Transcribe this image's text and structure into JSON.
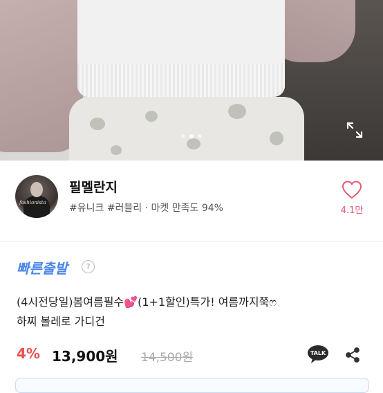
{
  "hero": {
    "slide_count": 3,
    "active_slide": 2
  },
  "seller": {
    "name": "필멜란지",
    "tags": "#유니크 #러블리 · 마켓 만족도 94%",
    "likes": "4.1만",
    "accent_color": "#e35a71"
  },
  "product": {
    "badge": "빠른출발",
    "help": "?",
    "title_line1_a": "(4시전당일)봄여름필수",
    "title_emoji": "💕",
    "title_line1_b": "(1+1할인)특가! 여름까지쭉ෆ",
    "title_line2": "하찌 볼레로 가디건",
    "discount": "4%",
    "price": "13,900원",
    "original_price": "14,500원",
    "talk_label": "TALK"
  }
}
